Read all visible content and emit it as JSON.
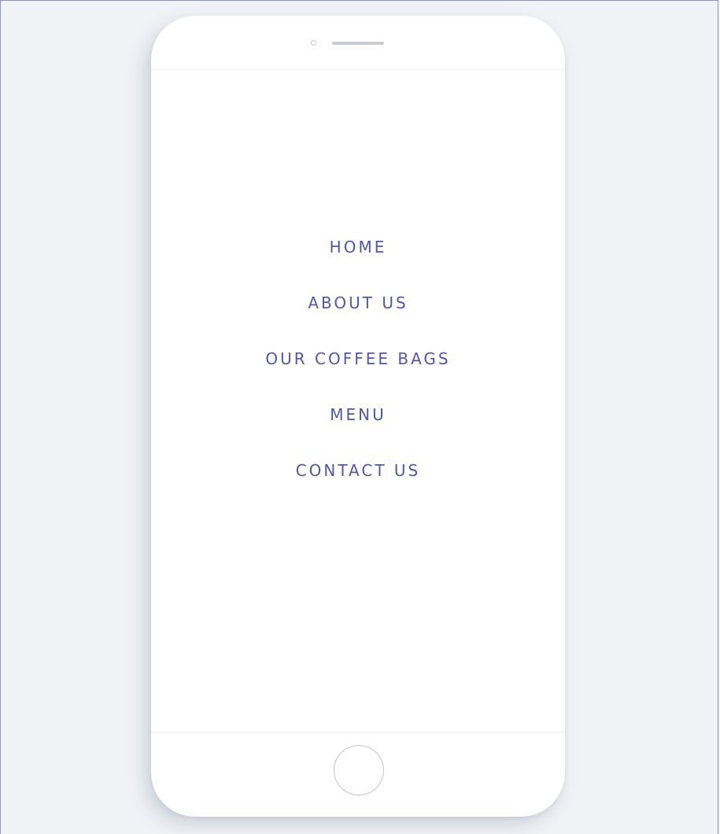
{
  "nav": {
    "items": [
      {
        "label": "HOME"
      },
      {
        "label": "ABOUT US"
      },
      {
        "label": "OUR COFFEE BAGS"
      },
      {
        "label": "MENU"
      },
      {
        "label": "CONTACT US"
      }
    ]
  },
  "colors": {
    "background": "#f0f2f6",
    "phone_body": "#ffffff",
    "nav_text": "#5257a6",
    "frame_border": "#8b8fd0"
  },
  "icons": {
    "camera": "camera-icon",
    "speaker": "speaker-icon",
    "home_button": "home-button-icon"
  }
}
